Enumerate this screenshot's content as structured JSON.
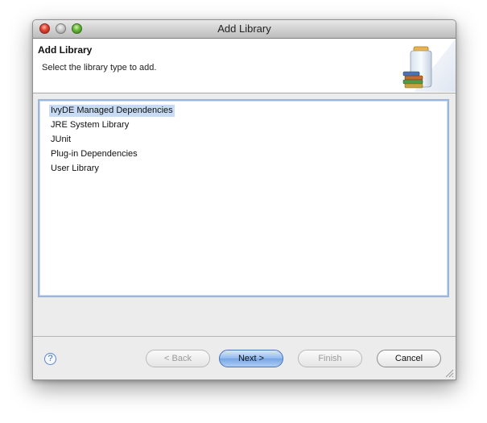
{
  "window": {
    "title": "Add Library"
  },
  "header": {
    "title": "Add Library",
    "subtitle": "Select the library type to add.",
    "art_icon": "library-jar-books-icon"
  },
  "library_types": [
    {
      "label": "IvyDE Managed Dependencies",
      "selected": true
    },
    {
      "label": "JRE System Library",
      "selected": false
    },
    {
      "label": "JUnit",
      "selected": false
    },
    {
      "label": "Plug-in Dependencies",
      "selected": false
    },
    {
      "label": "User Library",
      "selected": false
    }
  ],
  "footer": {
    "help_icon": "help-icon",
    "help_glyph": "?",
    "back_label": "< Back",
    "next_label": "Next >",
    "finish_label": "Finish",
    "cancel_label": "Cancel"
  },
  "colors": {
    "selection": "#c7dbf4",
    "list_border": "#9bb6d8",
    "default_button": "#8fb8ee"
  }
}
